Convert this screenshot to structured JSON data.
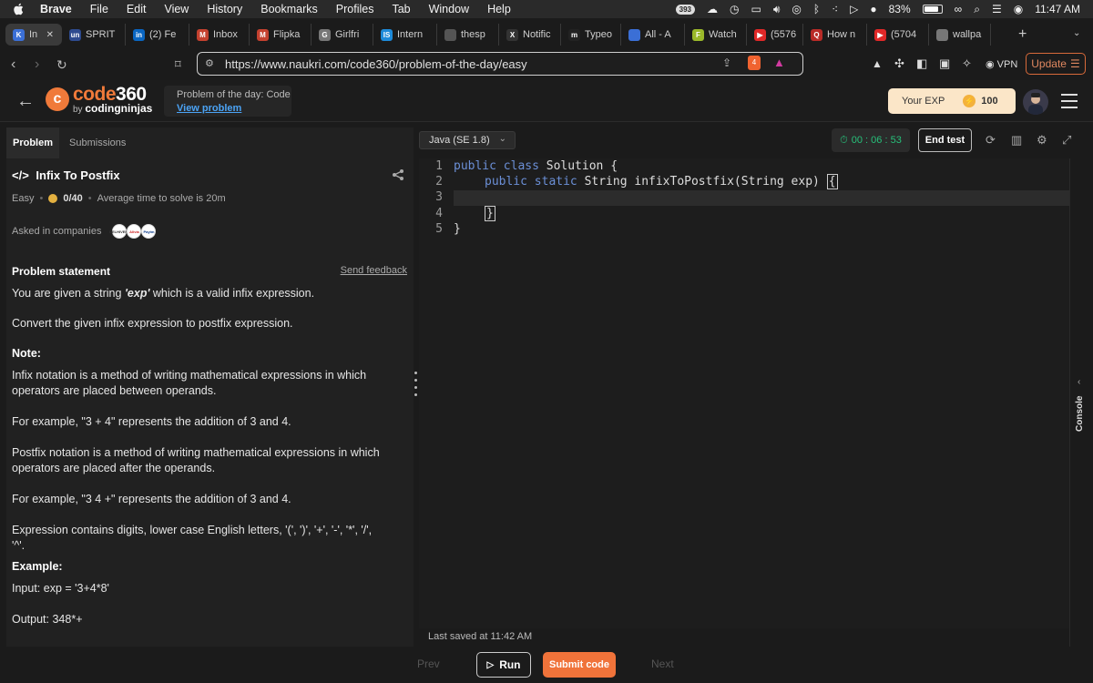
{
  "menubar": {
    "items": [
      "Brave",
      "File",
      "Edit",
      "View",
      "History",
      "Bookmarks",
      "Profiles",
      "Tab",
      "Window",
      "Help"
    ],
    "badge": "393",
    "battery": "83%",
    "clock": "11:47 AM"
  },
  "tabs": [
    {
      "label": "In",
      "icon": "K",
      "color": "#3b6fd6",
      "active": true
    },
    {
      "label": "SPRIT",
      "icon": "un",
      "color": "#2e4b8f"
    },
    {
      "label": "(2) Fe",
      "icon": "in",
      "color": "#0a66c2"
    },
    {
      "label": "Inbox",
      "icon": "M",
      "color": "#c4412f"
    },
    {
      "label": "Flipka",
      "icon": "M",
      "color": "#c4412f"
    },
    {
      "label": "Girlfri",
      "icon": "G",
      "color": "#777777"
    },
    {
      "label": "Intern",
      "icon": "IS",
      "color": "#1d8ad9"
    },
    {
      "label": "thesp",
      "icon": "",
      "color": "#555555"
    },
    {
      "label": "Notific",
      "icon": "X",
      "color": "#333333"
    },
    {
      "label": "Typeo",
      "icon": "m",
      "color": "#222222"
    },
    {
      "label": "All - A",
      "icon": "",
      "color": "#3b6fd6"
    },
    {
      "label": "Watch",
      "icon": "F",
      "color": "#9ab82a"
    },
    {
      "label": "(5576",
      "icon": "▶",
      "color": "#e02828"
    },
    {
      "label": "How n",
      "icon": "Q",
      "color": "#b92b27"
    },
    {
      "label": "(5704",
      "icon": "▶",
      "color": "#e02828"
    },
    {
      "label": "wallpa",
      "icon": "",
      "color": "#777777"
    }
  ],
  "address": {
    "url": "https://www.naukri.com/code360/problem-of-the-day/easy",
    "shield_count": "4",
    "vpn": "VPN",
    "update": "Update"
  },
  "header": {
    "logo_letter": "c",
    "logo_main": "code",
    "logo_num": "360",
    "logo_by": "by ",
    "logo_brand": "codingninjas",
    "potd_title": "Problem of the day: Code",
    "potd_link": "View problem",
    "exp_label": "Your EXP",
    "exp_value": "100"
  },
  "problem": {
    "tabs": [
      "Problem",
      "Submissions"
    ],
    "title": "Infix To Postfix",
    "difficulty": "Easy",
    "score": "0/40",
    "avg_time": "Average time to solve is 20m",
    "asked_label": "Asked in companies",
    "companies": [
      "DELHIVERY",
      "Alivia",
      "Paytm"
    ],
    "statement_head": "Problem statement",
    "feedback": "Send feedback",
    "p1_pre": "You are given a string ",
    "p1_em": "'exp'",
    "p1_post": " which is a valid infix expression.",
    "p2": "Convert the given infix expression to postfix expression.",
    "note_head": "Note:",
    "p3": "Infix notation is a method of writing mathematical expressions in which operators are placed between operands.",
    "p4": "For example, \"3 + 4\" represents the addition of 3 and 4.",
    "p5": "Postfix notation is a method of writing mathematical expressions in which operators are placed after the operands.",
    "p6": "For example, \"3 4 +\" represents the addition of 3 and 4.",
    "p7": "Expression contains digits, lower case English letters, '(', ')', '+', '-', '*', '/', '^'.",
    "example_head": "Example:",
    "input": "Input: exp = '3+4*8'",
    "output": "Output: 348*+"
  },
  "editor": {
    "language": "Java (SE 1.8)",
    "timer": "00 : 06 : 53",
    "end_test": "End test",
    "lines": [
      {
        "n": "1",
        "kw": "public class",
        "rest": " Solution {"
      },
      {
        "n": "2",
        "kw": "public static",
        "rest": " String infixToPostfix(String exp) "
      },
      {
        "n": "3",
        "kw": "",
        "rest": ""
      },
      {
        "n": "4",
        "kw": "",
        "rest": ""
      },
      {
        "n": "5",
        "kw": "",
        "rest": "}"
      }
    ],
    "open_brace": "{",
    "close_brace": "}",
    "saved": "Last saved at 11:42 AM",
    "console": "Console"
  },
  "footer": {
    "prev": "Prev",
    "run": "Run",
    "submit": "Submit code",
    "next": "Next"
  }
}
